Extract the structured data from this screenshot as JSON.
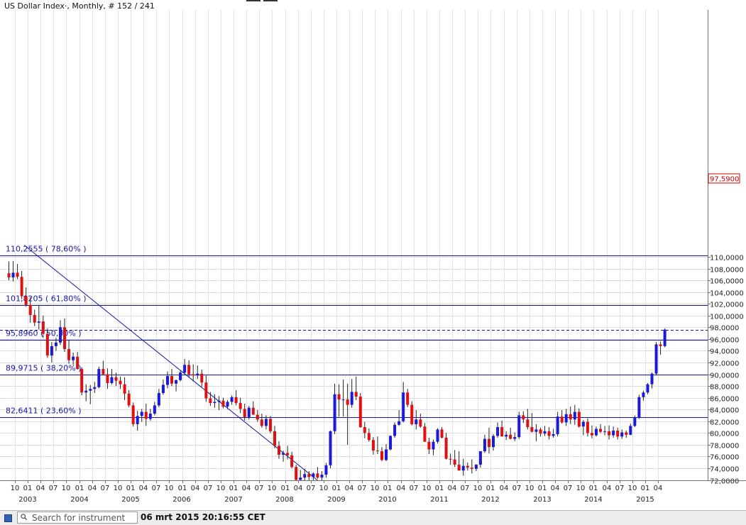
{
  "chart_data": {
    "type": "candlestick",
    "title": "US Dollar Index·, Monthly, # 152 / 241",
    "current_value_label": "97,5900",
    "current_value": 97.59,
    "ylim": [
      72,
      111
    ],
    "y_ticks": [
      "72,0000",
      "74,0000",
      "76,0000",
      "78,0000",
      "80,0000",
      "82,0000",
      "84,0000",
      "86,0000",
      "88,0000",
      "90,0000",
      "92,0000",
      "94,0000",
      "96,0000",
      "98,0000",
      "100,0000",
      "102,0000",
      "104,0000",
      "106,0000",
      "108,0000",
      "110,0000"
    ],
    "x_month_ticks": [
      "10",
      "01",
      "04",
      "07",
      "10",
      "01",
      "04",
      "07",
      "10",
      "01",
      "04",
      "07",
      "10",
      "01",
      "04",
      "07",
      "10",
      "01",
      "04",
      "07",
      "10",
      "01",
      "04",
      "07",
      "10",
      "01",
      "04",
      "07",
      "10",
      "01",
      "04",
      "07",
      "10",
      "01",
      "04",
      "07",
      "10",
      "01",
      "04",
      "07",
      "10",
      "01",
      "04",
      "07",
      "10",
      "01",
      "04",
      "07",
      "10",
      "01",
      "04"
    ],
    "x_year_ticks": [
      "2003",
      "2004",
      "2005",
      "2006",
      "2007",
      "2008",
      "2009",
      "2010",
      "2011",
      "2012",
      "2013",
      "2014",
      "2015"
    ],
    "fib_levels": [
      {
        "label": "110,2555 ( 78,60% )",
        "value": 110.2555
      },
      {
        "label": "101,8205 ( 61,80% )",
        "value": 101.8205
      },
      {
        "label": "95,8960 ( 50,00% )",
        "value": 95.896
      },
      {
        "label": "89,9715 ( 38,20% )",
        "value": 89.9715
      },
      {
        "label": "82,6411 ( 23,60% )",
        "value": 82.6411
      }
    ],
    "trendline": {
      "from": {
        "index": 0,
        "value": 112.0
      },
      "to": {
        "index": 76,
        "value": 71.0
      }
    },
    "candles": [
      {
        "o": 107.2,
        "h": 109.2,
        "l": 106.0,
        "c": 106.5
      },
      {
        "o": 106.5,
        "h": 109.3,
        "l": 105.8,
        "c": 107.3
      },
      {
        "o": 107.3,
        "h": 108.8,
        "l": 106.2,
        "c": 106.6
      },
      {
        "o": 106.6,
        "h": 107.6,
        "l": 102.8,
        "c": 103.3
      },
      {
        "o": 103.3,
        "h": 104.8,
        "l": 101.5,
        "c": 101.8
      },
      {
        "o": 101.8,
        "h": 103.2,
        "l": 98.8,
        "c": 100.1
      },
      {
        "o": 100.1,
        "h": 101.0,
        "l": 98.2,
        "c": 98.8
      },
      {
        "o": 98.8,
        "h": 101.8,
        "l": 97.6,
        "c": 99.0
      },
      {
        "o": 99.0,
        "h": 100.0,
        "l": 96.2,
        "c": 96.9
      },
      {
        "o": 96.9,
        "h": 97.8,
        "l": 92.8,
        "c": 93.2
      },
      {
        "o": 93.2,
        "h": 95.5,
        "l": 92.0,
        "c": 94.8
      },
      {
        "o": 94.8,
        "h": 96.2,
        "l": 94.0,
        "c": 95.4
      },
      {
        "o": 95.4,
        "h": 99.2,
        "l": 95.0,
        "c": 98.0
      },
      {
        "o": 98.0,
        "h": 99.5,
        "l": 93.8,
        "c": 94.3
      },
      {
        "o": 94.3,
        "h": 95.8,
        "l": 91.8,
        "c": 92.4
      },
      {
        "o": 92.4,
        "h": 93.7,
        "l": 91.6,
        "c": 93.0
      },
      {
        "o": 93.0,
        "h": 93.8,
        "l": 90.8,
        "c": 90.9
      },
      {
        "o": 90.9,
        "h": 91.2,
        "l": 86.4,
        "c": 86.9
      },
      {
        "o": 86.9,
        "h": 88.3,
        "l": 85.4,
        "c": 87.2
      },
      {
        "o": 87.2,
        "h": 88.2,
        "l": 84.9,
        "c": 87.5
      },
      {
        "o": 87.5,
        "h": 88.7,
        "l": 86.8,
        "c": 87.8
      },
      {
        "o": 87.8,
        "h": 91.3,
        "l": 87.6,
        "c": 90.9
      },
      {
        "o": 90.9,
        "h": 92.3,
        "l": 89.8,
        "c": 90.0
      },
      {
        "o": 90.0,
        "h": 91.0,
        "l": 87.5,
        "c": 88.5
      },
      {
        "o": 88.5,
        "h": 90.9,
        "l": 88.3,
        "c": 89.5
      },
      {
        "o": 89.5,
        "h": 90.3,
        "l": 88.0,
        "c": 88.9
      },
      {
        "o": 88.9,
        "h": 89.6,
        "l": 87.5,
        "c": 88.3
      },
      {
        "o": 88.3,
        "h": 89.5,
        "l": 85.6,
        "c": 86.7
      },
      {
        "o": 86.7,
        "h": 87.3,
        "l": 84.4,
        "c": 84.7
      },
      {
        "o": 84.7,
        "h": 85.2,
        "l": 81.1,
        "c": 81.5
      },
      {
        "o": 81.5,
        "h": 83.8,
        "l": 80.4,
        "c": 82.9
      },
      {
        "o": 82.9,
        "h": 84.1,
        "l": 81.9,
        "c": 83.6
      },
      {
        "o": 83.6,
        "h": 85.0,
        "l": 81.2,
        "c": 82.4
      },
      {
        "o": 82.4,
        "h": 84.1,
        "l": 82.1,
        "c": 83.3
      },
      {
        "o": 83.3,
        "h": 85.3,
        "l": 83.0,
        "c": 84.7
      },
      {
        "o": 84.7,
        "h": 87.5,
        "l": 84.4,
        "c": 86.8
      },
      {
        "o": 86.8,
        "h": 89.1,
        "l": 86.5,
        "c": 88.2
      },
      {
        "o": 88.2,
        "h": 90.5,
        "l": 87.6,
        "c": 89.7
      },
      {
        "o": 89.7,
        "h": 90.9,
        "l": 88.0,
        "c": 88.4
      },
      {
        "o": 88.4,
        "h": 89.1,
        "l": 87.1,
        "c": 89.0
      },
      {
        "o": 89.0,
        "h": 90.7,
        "l": 88.8,
        "c": 90.3
      },
      {
        "o": 90.3,
        "h": 92.6,
        "l": 90.0,
        "c": 91.6
      },
      {
        "o": 91.6,
        "h": 92.4,
        "l": 89.5,
        "c": 90.0
      },
      {
        "o": 90.0,
        "h": 91.7,
        "l": 88.8,
        "c": 89.8
      },
      {
        "o": 89.8,
        "h": 91.5,
        "l": 89.2,
        "c": 90.1
      },
      {
        "o": 90.1,
        "h": 90.8,
        "l": 87.9,
        "c": 88.6
      },
      {
        "o": 88.6,
        "h": 89.8,
        "l": 85.3,
        "c": 85.9
      },
      {
        "o": 85.9,
        "h": 87.0,
        "l": 84.6,
        "c": 85.1
      },
      {
        "o": 85.1,
        "h": 86.6,
        "l": 84.3,
        "c": 85.3
      },
      {
        "o": 85.3,
        "h": 86.3,
        "l": 83.9,
        "c": 85.5
      },
      {
        "o": 85.5,
        "h": 86.0,
        "l": 84.2,
        "c": 84.5
      },
      {
        "o": 84.5,
        "h": 85.6,
        "l": 84.1,
        "c": 85.3
      },
      {
        "o": 85.3,
        "h": 86.4,
        "l": 84.8,
        "c": 86.1
      },
      {
        "o": 86.1,
        "h": 87.3,
        "l": 84.7,
        "c": 85.1
      },
      {
        "o": 85.1,
        "h": 86.0,
        "l": 83.4,
        "c": 84.1
      },
      {
        "o": 84.1,
        "h": 85.0,
        "l": 82.1,
        "c": 82.7
      },
      {
        "o": 82.7,
        "h": 84.6,
        "l": 82.3,
        "c": 84.3
      },
      {
        "o": 84.3,
        "h": 85.4,
        "l": 83.3,
        "c": 83.1
      },
      {
        "o": 83.1,
        "h": 83.9,
        "l": 81.9,
        "c": 82.3
      },
      {
        "o": 82.3,
        "h": 83.3,
        "l": 80.9,
        "c": 81.2
      },
      {
        "o": 81.2,
        "h": 83.0,
        "l": 80.6,
        "c": 82.4
      },
      {
        "o": 82.4,
        "h": 82.9,
        "l": 80.0,
        "c": 80.3
      },
      {
        "o": 80.3,
        "h": 81.2,
        "l": 77.4,
        "c": 77.8
      },
      {
        "o": 77.8,
        "h": 78.6,
        "l": 75.6,
        "c": 76.3
      },
      {
        "o": 76.3,
        "h": 77.0,
        "l": 75.1,
        "c": 76.6
      },
      {
        "o": 76.6,
        "h": 77.8,
        "l": 75.5,
        "c": 76.2
      },
      {
        "o": 76.2,
        "h": 76.8,
        "l": 74.0,
        "c": 74.2
      },
      {
        "o": 74.2,
        "h": 74.6,
        "l": 71.3,
        "c": 72.0
      },
      {
        "o": 72.0,
        "h": 73.7,
        "l": 70.7,
        "c": 72.4
      },
      {
        "o": 72.4,
        "h": 73.9,
        "l": 71.8,
        "c": 73.0
      },
      {
        "o": 73.0,
        "h": 73.5,
        "l": 71.9,
        "c": 72.5
      },
      {
        "o": 72.5,
        "h": 73.3,
        "l": 71.7,
        "c": 73.1
      },
      {
        "o": 73.1,
        "h": 74.2,
        "l": 72.2,
        "c": 72.4
      },
      {
        "o": 72.4,
        "h": 73.5,
        "l": 71.8,
        "c": 72.9
      },
      {
        "o": 72.9,
        "h": 74.9,
        "l": 72.4,
        "c": 74.5
      },
      {
        "o": 74.5,
        "h": 80.4,
        "l": 74.0,
        "c": 80.3
      },
      {
        "o": 80.3,
        "h": 88.4,
        "l": 79.8,
        "c": 86.6
      },
      {
        "o": 86.6,
        "h": 88.3,
        "l": 82.8,
        "c": 85.7
      },
      {
        "o": 85.7,
        "h": 89.1,
        "l": 82.8,
        "c": 85.7
      },
      {
        "o": 85.7,
        "h": 88.4,
        "l": 78.0,
        "c": 84.8
      },
      {
        "o": 84.8,
        "h": 89.2,
        "l": 84.3,
        "c": 87.0
      },
      {
        "o": 87.0,
        "h": 89.6,
        "l": 85.6,
        "c": 86.2
      },
      {
        "o": 86.2,
        "h": 86.8,
        "l": 80.9,
        "c": 81.0
      },
      {
        "o": 81.0,
        "h": 81.9,
        "l": 79.1,
        "c": 80.0
      },
      {
        "o": 80.0,
        "h": 80.8,
        "l": 78.5,
        "c": 78.8
      },
      {
        "o": 78.8,
        "h": 79.3,
        "l": 76.3,
        "c": 77.0
      },
      {
        "o": 77.0,
        "h": 79.4,
        "l": 76.4,
        "c": 76.9
      },
      {
        "o": 76.9,
        "h": 77.6,
        "l": 75.2,
        "c": 75.4
      },
      {
        "o": 75.4,
        "h": 78.1,
        "l": 75.2,
        "c": 77.2
      },
      {
        "o": 77.2,
        "h": 79.6,
        "l": 77.0,
        "c": 79.5
      },
      {
        "o": 79.5,
        "h": 81.8,
        "l": 79.2,
        "c": 81.4
      },
      {
        "o": 81.4,
        "h": 83.9,
        "l": 81.2,
        "c": 82.0
      },
      {
        "o": 82.0,
        "h": 88.7,
        "l": 81.8,
        "c": 86.9
      },
      {
        "o": 86.9,
        "h": 87.5,
        "l": 84.4,
        "c": 84.8
      },
      {
        "o": 84.8,
        "h": 85.4,
        "l": 81.3,
        "c": 81.5
      },
      {
        "o": 81.5,
        "h": 83.9,
        "l": 80.6,
        "c": 82.3
      },
      {
        "o": 82.3,
        "h": 83.3,
        "l": 80.9,
        "c": 81.1
      },
      {
        "o": 81.1,
        "h": 81.7,
        "l": 78.6,
        "c": 78.5
      },
      {
        "o": 78.5,
        "h": 79.2,
        "l": 76.4,
        "c": 77.2
      },
      {
        "o": 77.2,
        "h": 78.9,
        "l": 76.2,
        "c": 78.5
      },
      {
        "o": 78.5,
        "h": 80.8,
        "l": 78.2,
        "c": 80.6
      },
      {
        "o": 80.6,
        "h": 81.0,
        "l": 79.1,
        "c": 79.2
      },
      {
        "o": 79.2,
        "h": 80.0,
        "l": 75.5,
        "c": 75.6
      },
      {
        "o": 75.6,
        "h": 76.5,
        "l": 74.6,
        "c": 75.5
      },
      {
        "o": 75.5,
        "h": 77.1,
        "l": 74.2,
        "c": 74.6
      },
      {
        "o": 74.6,
        "h": 76.9,
        "l": 74.4,
        "c": 73.6
      },
      {
        "o": 73.6,
        "h": 75.6,
        "l": 72.7,
        "c": 74.4
      },
      {
        "o": 74.4,
        "h": 75.0,
        "l": 73.6,
        "c": 74.1
      },
      {
        "o": 74.1,
        "h": 75.5,
        "l": 73.1,
        "c": 73.9
      },
      {
        "o": 73.9,
        "h": 74.7,
        "l": 73.5,
        "c": 74.6
      },
      {
        "o": 74.6,
        "h": 76.4,
        "l": 74.1,
        "c": 76.9
      },
      {
        "o": 76.9,
        "h": 79.7,
        "l": 76.6,
        "c": 79.0
      },
      {
        "o": 79.0,
        "h": 80.9,
        "l": 76.5,
        "c": 77.6
      },
      {
        "o": 77.6,
        "h": 79.8,
        "l": 77.0,
        "c": 79.5
      },
      {
        "o": 79.5,
        "h": 81.8,
        "l": 79.2,
        "c": 81.0
      },
      {
        "o": 81.0,
        "h": 82.1,
        "l": 79.4,
        "c": 79.4
      },
      {
        "o": 79.4,
        "h": 80.3,
        "l": 78.8,
        "c": 79.7
      },
      {
        "o": 79.7,
        "h": 80.9,
        "l": 78.9,
        "c": 79.0
      },
      {
        "o": 79.0,
        "h": 80.1,
        "l": 78.6,
        "c": 79.3
      },
      {
        "o": 79.3,
        "h": 83.6,
        "l": 79.0,
        "c": 83.0
      },
      {
        "o": 83.0,
        "h": 83.7,
        "l": 81.7,
        "c": 82.3
      },
      {
        "o": 82.3,
        "h": 84.1,
        "l": 80.6,
        "c": 81.0
      },
      {
        "o": 81.0,
        "h": 83.4,
        "l": 80.1,
        "c": 80.2
      },
      {
        "o": 80.2,
        "h": 81.5,
        "l": 78.6,
        "c": 80.6
      },
      {
        "o": 80.6,
        "h": 80.9,
        "l": 79.4,
        "c": 79.9
      },
      {
        "o": 79.9,
        "h": 81.2,
        "l": 79.5,
        "c": 80.3
      },
      {
        "o": 80.3,
        "h": 81.0,
        "l": 78.9,
        "c": 79.5
      },
      {
        "o": 79.5,
        "h": 80.7,
        "l": 79.2,
        "c": 79.8
      },
      {
        "o": 79.8,
        "h": 83.6,
        "l": 79.4,
        "c": 82.8
      },
      {
        "o": 82.8,
        "h": 83.9,
        "l": 81.6,
        "c": 81.8
      },
      {
        "o": 81.8,
        "h": 84.1,
        "l": 81.2,
        "c": 83.2
      },
      {
        "o": 83.2,
        "h": 84.5,
        "l": 81.5,
        "c": 82.3
      },
      {
        "o": 82.3,
        "h": 84.8,
        "l": 81.4,
        "c": 83.6
      },
      {
        "o": 83.6,
        "h": 84.2,
        "l": 80.9,
        "c": 81.1
      },
      {
        "o": 81.1,
        "h": 82.2,
        "l": 79.6,
        "c": 81.9
      },
      {
        "o": 81.9,
        "h": 82.5,
        "l": 79.4,
        "c": 80.0
      },
      {
        "o": 80.0,
        "h": 81.3,
        "l": 79.1,
        "c": 79.6
      },
      {
        "o": 79.6,
        "h": 81.1,
        "l": 79.4,
        "c": 80.7
      },
      {
        "o": 80.7,
        "h": 81.5,
        "l": 80.0,
        "c": 80.2
      },
      {
        "o": 80.2,
        "h": 81.2,
        "l": 79.6,
        "c": 80.3
      },
      {
        "o": 80.3,
        "h": 81.3,
        "l": 78.9,
        "c": 79.6
      },
      {
        "o": 79.6,
        "h": 81.1,
        "l": 79.2,
        "c": 80.4
      },
      {
        "o": 80.4,
        "h": 80.9,
        "l": 78.9,
        "c": 79.4
      },
      {
        "o": 79.4,
        "h": 80.6,
        "l": 79.0,
        "c": 80.1
      },
      {
        "o": 80.1,
        "h": 80.4,
        "l": 79.2,
        "c": 79.7
      },
      {
        "o": 79.7,
        "h": 81.6,
        "l": 79.6,
        "c": 81.2
      },
      {
        "o": 81.2,
        "h": 83.0,
        "l": 81.0,
        "c": 82.6
      },
      {
        "o": 82.6,
        "h": 86.5,
        "l": 82.4,
        "c": 86.1
      },
      {
        "o": 86.1,
        "h": 87.2,
        "l": 85.5,
        "c": 86.9
      },
      {
        "o": 86.9,
        "h": 88.5,
        "l": 86.6,
        "c": 88.3
      },
      {
        "o": 88.3,
        "h": 90.3,
        "l": 87.6,
        "c": 90.1
      },
      {
        "o": 90.1,
        "h": 95.5,
        "l": 89.8,
        "c": 95.1
      },
      {
        "o": 95.1,
        "h": 95.6,
        "l": 93.3,
        "c": 94.8
      },
      {
        "o": 94.8,
        "h": 97.8,
        "l": 94.6,
        "c": 97.6
      }
    ]
  }
}
